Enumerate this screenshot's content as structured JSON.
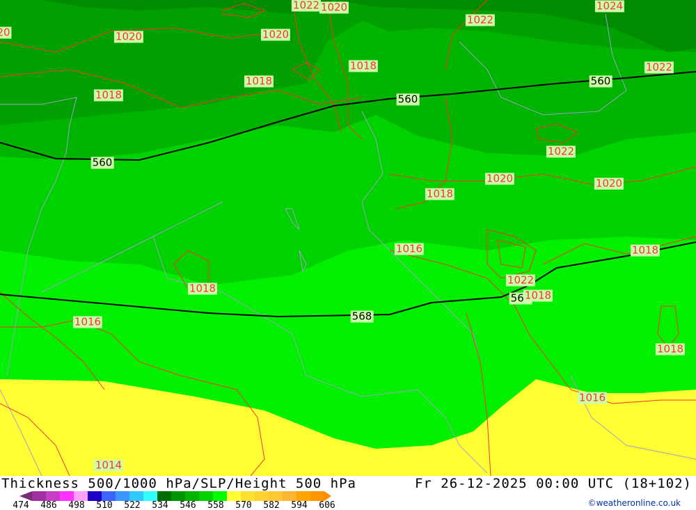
{
  "title": "Thickness 500/1000 hPa/SLP/Height 500 hPa",
  "datetime": "Fr 26-12-2025 00:00 UTC (18+102)",
  "credit": "©weatheronline.co.uk",
  "legend": {
    "ticks": [
      "474",
      "486",
      "498",
      "510",
      "522",
      "534",
      "546",
      "558",
      "570",
      "582",
      "594",
      "606"
    ],
    "colors": [
      "#7a2e7a",
      "#a030a0",
      "#c83cc8",
      "#ff32ff",
      "#ffa0ff",
      "#1e00c8",
      "#3c64ff",
      "#3c96ff",
      "#32c8ff",
      "#32ffff",
      "#006e00",
      "#009600",
      "#00b400",
      "#00d200",
      "#00ff00",
      "#ffff32",
      "#ffe132",
      "#ffd232",
      "#ffc832",
      "#ffb432",
      "#ffa500",
      "#ff9600",
      "#ff8c00"
    ]
  },
  "map_colors": {
    "band1": "#008c00",
    "band2": "#00a000",
    "band3": "#00b400",
    "band4": "#00d200",
    "band5": "#00f000",
    "band6": "#ffff33",
    "isobar": "#ff3030",
    "border": "#a0a0c8",
    "thickness_line": "#000000"
  },
  "isobar_labels": [
    "20",
    "1020",
    "1022",
    "1020",
    "1022",
    "1024",
    "1020",
    "1018",
    "1018",
    "1018",
    "1022",
    "1022",
    "1020",
    "1020",
    "1018",
    "1016",
    "1018",
    "1022",
    "1018",
    "1018",
    "1016",
    "1018",
    "1016",
    "1014"
  ],
  "thickness_labels": [
    "560",
    "560",
    "560",
    "568",
    "568"
  ]
}
